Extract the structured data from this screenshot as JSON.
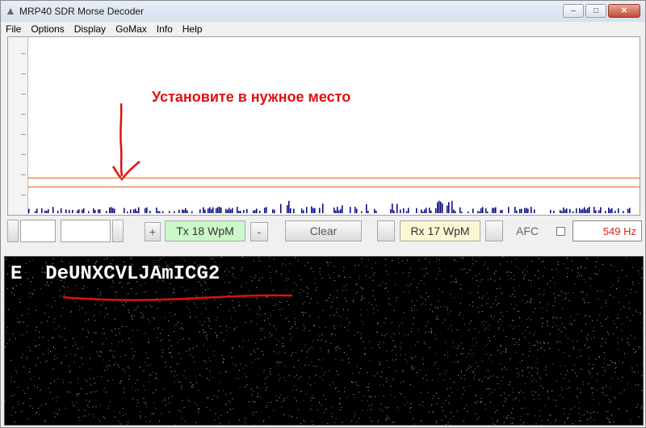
{
  "window": {
    "title": "MRP40 SDR Morse Decoder"
  },
  "title_buttons": {
    "minimize": "–",
    "maximize": "□",
    "close": "✕"
  },
  "menu": [
    "File",
    "Options",
    "Display",
    "GoMax",
    "Info",
    "Help"
  ],
  "spectrum": {
    "annotation": "Установите в нужное место",
    "annotation_color": "#e01010",
    "marker_color": "#d46a2a",
    "signal_color": "#000080"
  },
  "controls": {
    "plus_label": "+",
    "tx_label": "Tx 18 WpM",
    "minus_label": "-",
    "clear_label": "Clear",
    "rx_label": "Rx 17 WpM",
    "afc_label": "AFC",
    "hz_value": "549 Hz",
    "tx_color": "#ccf7c8",
    "rx_color": "#fbf7d4"
  },
  "decoder": {
    "text": "E  DeUNXCVLJAmICG2",
    "background": "#000000",
    "text_color": "#ffffff"
  }
}
